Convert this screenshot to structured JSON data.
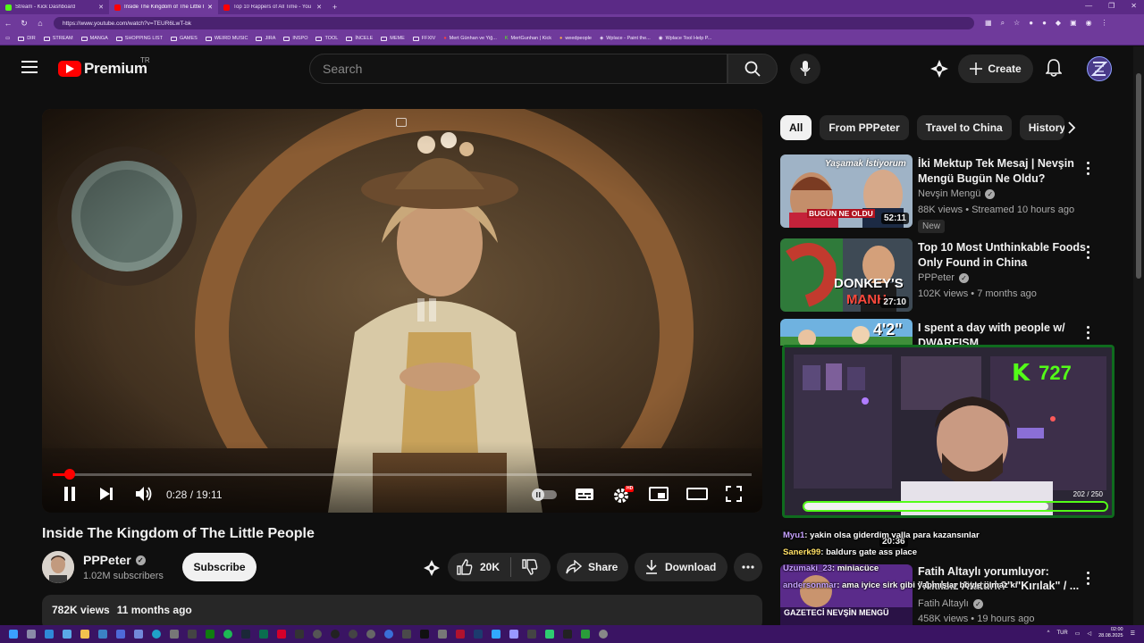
{
  "browser": {
    "tabs": [
      {
        "label": "Stream - Kick Dashboard",
        "color": "#53fc18"
      },
      {
        "label": "Inside The Kingdom of The Little People",
        "color": "#ff0000"
      },
      {
        "label": "Top 10 Rappers of All Time - You",
        "color": "#ff0000"
      }
    ],
    "url": "https://www.youtube.com/watch?v=TEUR6LwT-bk",
    "bookmarks": [
      "DIR",
      "STREAM",
      "MANGA",
      "SHOPPING LIST",
      "GAMES",
      "WEIRD MUSIC",
      "JIRA",
      "INSPO",
      "TOOL",
      "İNCELE",
      "MEME",
      "FFXIV",
      "Mert Günhan ve Yiğ...",
      "MertGunhan | Kick",
      "weedpeople",
      "Wplace - Paint the...",
      "Wplace Tool Help P..."
    ]
  },
  "youtube": {
    "logo_text": "Premium",
    "country_code": "TR",
    "search_placeholder": "Search",
    "create_label": "Create"
  },
  "player": {
    "current_time": "0:28",
    "duration": "19:11",
    "time_display": "0:28 / 19:11",
    "progress": 0.024,
    "hd_badge": "HD"
  },
  "video": {
    "title": "Inside The Kingdom of The Little People",
    "channel": "PPPeter",
    "subscribers": "1.02M subscribers",
    "subscribe_label": "Subscribe",
    "likes": "20K",
    "share_label": "Share",
    "download_label": "Download",
    "views": "782K views",
    "age": "11 months ago"
  },
  "chips": [
    "All",
    "From PPPeter",
    "Travel to China",
    "History"
  ],
  "recommendations": [
    {
      "title": "İki Mektup Tek Mesaj | Nevşin Mengü Bugün Ne Oldu?",
      "channel": "Nevşin Mengü",
      "meta": "88K views • Streamed 10 hours ago",
      "badge": "New",
      "duration": "52:11",
      "thumb_top": "Yaşamak İstiyorum",
      "thumb_bottom": "BUGÜN NE OLDU"
    },
    {
      "title": "Top 10 Most Unthinkable Foods Only Found in China",
      "channel": "PPPeter",
      "meta": "102K views • 7 months ago",
      "duration": "27:10",
      "thumb_text": "DONKEY'S",
      "thumb_text2": "MANH"
    },
    {
      "title": "I spent a day with people w/ DWARFISM",
      "thumb_text": "4'2\""
    },
    {
      "title": "Fatih Altaylı yorumluyor: \"Akılsız Atatürk?\" \"Kırılak\" / ...",
      "channel": "Fatih Altaylı",
      "meta": "458K views • 19 hours ago",
      "duration": "20:36",
      "thumb_text": "GAZETECİ NEVŞİN MENGÜ"
    }
  ],
  "stream_overlay": {
    "viewer_count": "727",
    "goal_current": 202,
    "goal_total": 250,
    "goal_text": "202 / 250",
    "accent": "#53fc18",
    "chat": [
      {
        "user": "Myu1",
        "text": ": yakin olsa giderdim valla para kazansınlar"
      },
      {
        "user": "Sanerk99",
        "text": ": baldurs gate ass place"
      },
      {
        "user": "Uzumaki_23",
        "text": ": miniacüce"
      },
      {
        "user": "andersonmar",
        "text": ": ama iyice sirk gibi yapmışlar böyle olmaz ki"
      }
    ]
  },
  "taskbar": {
    "lang": "TUR",
    "time": "02:00",
    "date": "28.08.2025"
  }
}
